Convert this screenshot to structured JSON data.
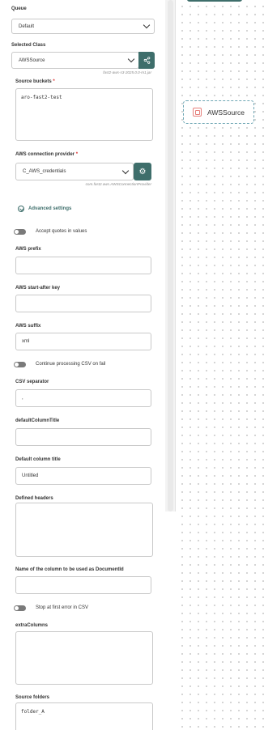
{
  "queue": {
    "label": "Queue",
    "value": "Default"
  },
  "selected_class": {
    "label": "Selected Class",
    "value": "AWSSource",
    "hint": "fast2-aws-s3-2025.0.0-m1.jar"
  },
  "source_buckets": {
    "label": "Source buckets",
    "value": "aro-fast2-test"
  },
  "connection_provider": {
    "label": "AWS connection provider",
    "value": "C_AWS_credentials",
    "hint": "com.fast2.aws.AWSConnectionProvider"
  },
  "advanced": {
    "label": "Advanced settings"
  },
  "accept_quotes": {
    "label": "Accept quotes in values"
  },
  "aws_prefix": {
    "label": "AWS prefix",
    "value": ""
  },
  "aws_start_after": {
    "label": "AWS start-after key",
    "value": ""
  },
  "aws_suffix": {
    "label": "AWS suffix",
    "value": "xml"
  },
  "continue_csv": {
    "label": "Continue processing CSV on fail"
  },
  "csv_separator": {
    "label": "CSV separator",
    "value": ","
  },
  "default_column_title_camel": {
    "label": "defaultColumnTitle",
    "value": ""
  },
  "default_column_title": {
    "label": "Default column title",
    "value": "Untitled"
  },
  "defined_headers": {
    "label": "Defined headers",
    "value": ""
  },
  "document_id_column": {
    "label": "Name of the column to be used as DocumentId",
    "value": ""
  },
  "stop_first_error": {
    "label": "Stop at first error in CSV"
  },
  "extra_columns": {
    "label": "extraColumns",
    "value": ""
  },
  "source_folders": {
    "label": "Source folders",
    "value": "folder_A"
  },
  "canvas": {
    "node_label": "AWSSource"
  },
  "colors": {
    "accent": "#3e6e6b",
    "required": "#dd3333",
    "node_border": "#6ea6b4",
    "node_icon": "#e6807c"
  }
}
